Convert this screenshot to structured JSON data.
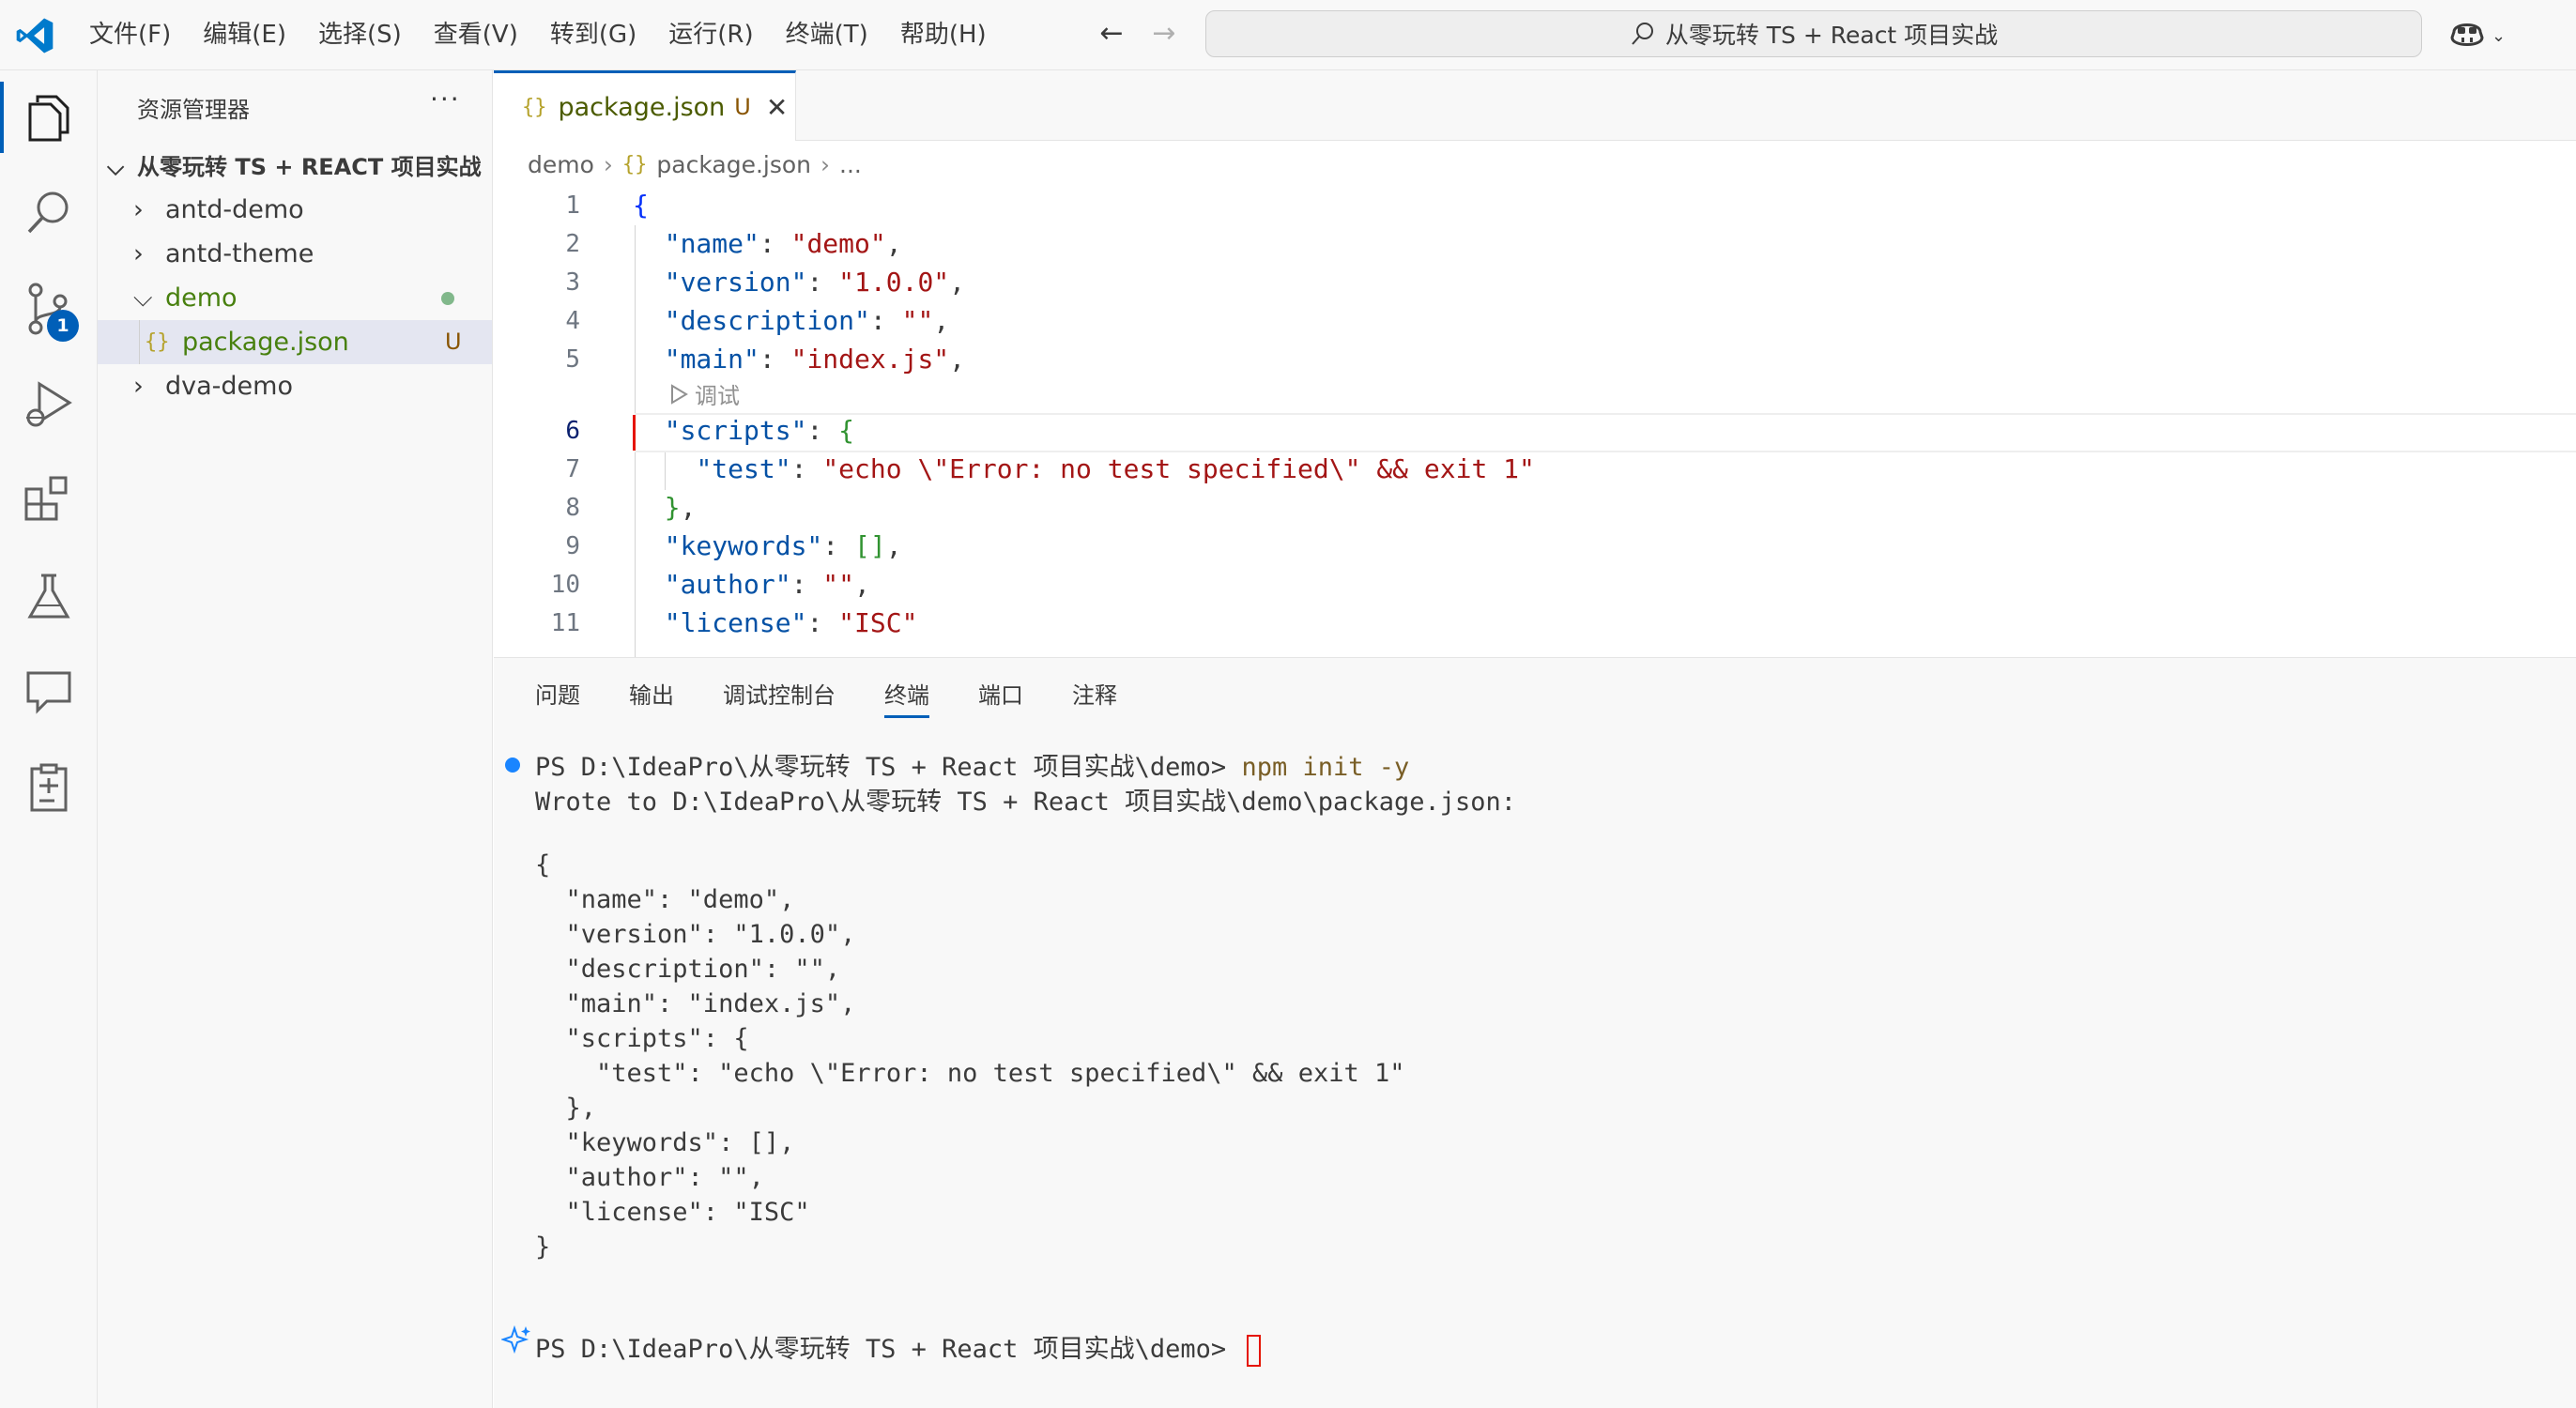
{
  "menu": [
    "文件(F)",
    "编辑(E)",
    "选择(S)",
    "查看(V)",
    "转到(G)",
    "运行(R)",
    "终端(T)",
    "帮助(H)"
  ],
  "search": {
    "text": "从零玩转 TS + React 项目实战"
  },
  "activity": {
    "scm_badge": "1"
  },
  "explorer": {
    "title": "资源管理器",
    "more": "···",
    "root": "从零玩转 TS + REACT 项目实战",
    "items": [
      {
        "label": "antd-demo"
      },
      {
        "label": "antd-theme"
      },
      {
        "label": "demo"
      },
      {
        "label": "package.json",
        "status": "U"
      },
      {
        "label": "dva-demo"
      }
    ]
  },
  "tab": {
    "icon": "{}",
    "label": "package.json",
    "status": "U",
    "close": "✕"
  },
  "breadcrumb": {
    "folder": "demo",
    "file": "package.json",
    "more": "..."
  },
  "editor": {
    "line_numbers": [
      "1",
      "2",
      "3",
      "4",
      "5",
      "6",
      "7",
      "8",
      "9",
      "10",
      "11"
    ],
    "codelens": "调试"
  },
  "panel": {
    "tabs": [
      "问题",
      "输出",
      "调试控制台",
      "终端",
      "端口",
      "注释"
    ],
    "active_tab": "终端"
  },
  "terminal": {
    "prompt1": "PS D:\\IdeaPro\\从零玩转 TS + React 项目实战\\demo> ",
    "command": "npm init -y",
    "wrote": "Wrote to D:\\IdeaPro\\从零玩转 TS + React 项目实战\\demo\\package.json:",
    "output": [
      "{",
      "  \"name\": \"demo\",",
      "  \"version\": \"1.0.0\",",
      "  \"description\": \"\",",
      "  \"main\": \"index.js\",",
      "  \"scripts\": {",
      "    \"test\": \"echo \\\"Error: no test specified\\\" && exit 1\"",
      "  },",
      "  \"keywords\": [],",
      "  \"author\": \"\",",
      "  \"license\": \"ISC\"",
      "}"
    ],
    "prompt2": "PS D:\\IdeaPro\\从零玩转 TS + React 项目实战\\demo> "
  }
}
